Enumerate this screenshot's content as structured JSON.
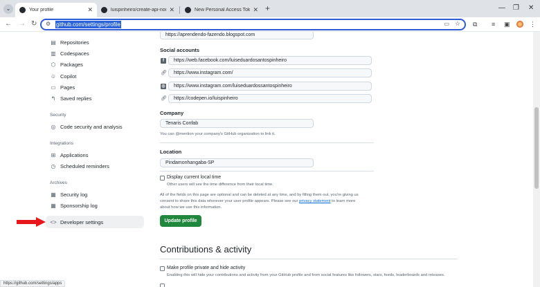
{
  "browser": {
    "tabs": [
      {
        "title": "Your profile",
        "active": true
      },
      {
        "title": "luispinheiro/create-api-nodejs"
      },
      {
        "title": "New Personal Access Token (Cla"
      }
    ],
    "new_tab": "+",
    "url": "github.com/settings/profile",
    "status_url": "https://github.com/settings/apps"
  },
  "sidebar": {
    "top_items": [
      {
        "label": "Repositories",
        "icon": "repo-icon"
      },
      {
        "label": "Codespaces",
        "icon": "codespaces-icon"
      },
      {
        "label": "Packages",
        "icon": "package-icon"
      },
      {
        "label": "Copilot",
        "icon": "copilot-icon"
      },
      {
        "label": "Pages",
        "icon": "pages-icon"
      },
      {
        "label": "Saved replies",
        "icon": "reply-icon"
      }
    ],
    "security_heading": "Security",
    "security_items": [
      {
        "label": "Code security and analysis",
        "icon": "shield-icon"
      }
    ],
    "integrations_heading": "Integrations",
    "integrations_items": [
      {
        "label": "Applications",
        "icon": "apps-icon"
      },
      {
        "label": "Scheduled reminders",
        "icon": "clock-icon"
      }
    ],
    "archives_heading": "Archives",
    "archives_items": [
      {
        "label": "Security log",
        "icon": "log-icon"
      },
      {
        "label": "Sponsorship log",
        "icon": "log-icon"
      }
    ],
    "developer_settings": "Developer settings",
    "arrow_color": "#e8171c"
  },
  "profile": {
    "website_value": "https://aprendendo-fazendo.blogspot.com",
    "social_label": "Social accounts",
    "social": [
      "https://web.facebook.com/luiseduardosantospinheiro",
      "https://www.instagram.com/",
      "https://www.instagram.com/luiseduardossantospinheiro",
      "https://codepen.io/luispinheiro"
    ],
    "company_label": "Company",
    "company_value": "Tenaris Confab",
    "company_note": "You can @mention your company's GitHub organization to link it.",
    "location_label": "Location",
    "location_value": "Pindamonhangaba-SP",
    "display_time_label": "Display current local time",
    "display_time_note": "Other users will see the time difference from their local time.",
    "optional_note_1": "All of the fields on this page are optional and can be deleted at any time, and by filling them out, you're giving us",
    "optional_note_2": "consent to share this data wherever your user profile appears. Please see our",
    "privacy_link": "privacy statement",
    "optional_note_3": "to learn more",
    "optional_note_4": "about how we use this information.",
    "update_button": "Update profile",
    "contributions_title": "Contributions & activity",
    "private_label": "Make profile private and hide activity",
    "private_note": "Enabling this will hide your contributions and activity from your GitHub profile and from social features like followers, stars, feeds, leaderboards and releases."
  }
}
